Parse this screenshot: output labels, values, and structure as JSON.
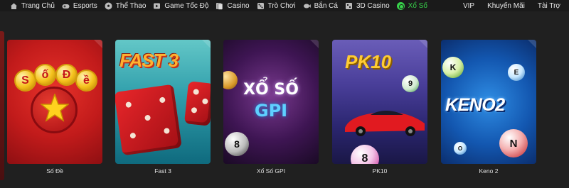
{
  "nav": {
    "left": [
      {
        "label": "Trang Chủ",
        "icon": "home-icon"
      },
      {
        "label": "Esports",
        "icon": "gamepad-icon"
      },
      {
        "label": "Thể Thao",
        "icon": "soccer-ball-icon"
      },
      {
        "label": "Game Tốc Độ",
        "icon": "speed-game-icon"
      },
      {
        "label": "Casino",
        "icon": "casino-icon"
      },
      {
        "label": "Trò Chơi",
        "icon": "game-icon"
      },
      {
        "label": "Bắn Cá",
        "icon": "fish-icon"
      },
      {
        "label": "3D Casino",
        "icon": "3d-casino-icon"
      },
      {
        "label": "Xổ Số",
        "icon": "lottery-icon",
        "active": true
      }
    ],
    "right": [
      {
        "label": "VIP"
      },
      {
        "label": "Khuyến Mãi"
      },
      {
        "label": "Tài Trợ"
      }
    ],
    "active_color": "#37d24a"
  },
  "games": [
    {
      "title": "Số Đề",
      "art_text": [
        "S",
        "ố",
        "Đ",
        "ề"
      ]
    },
    {
      "title": "Fast 3",
      "art_text": "FAST 3"
    },
    {
      "title": "Xổ Số GPI",
      "art_text": [
        "XỔ SỐ",
        "GPI"
      ]
    },
    {
      "title": "PK10",
      "art_text": "PK10"
    },
    {
      "title": "Keno 2",
      "art_text": "KENO2"
    }
  ]
}
